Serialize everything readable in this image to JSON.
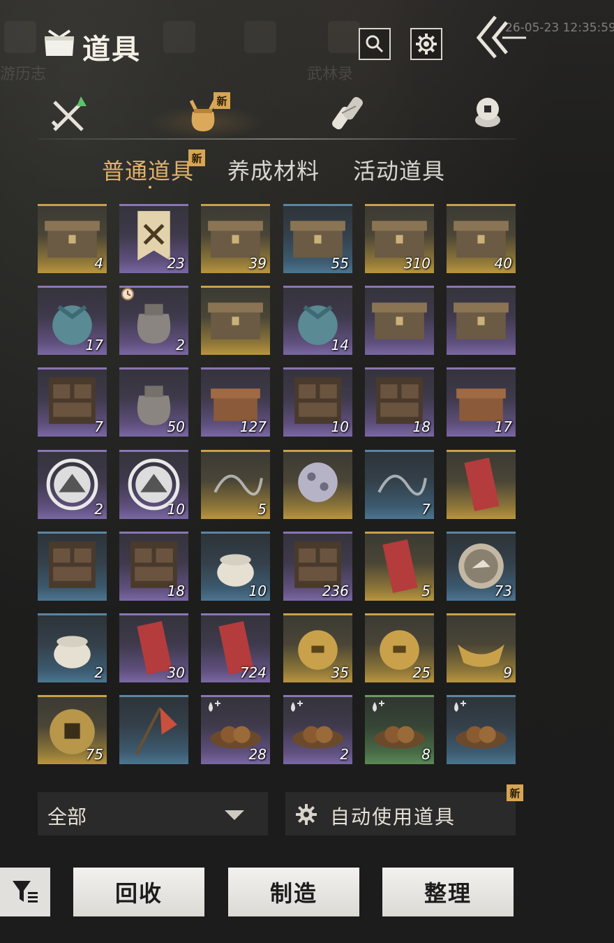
{
  "background": {
    "menu_items": [
      "游历志",
      "",
      "",
      "",
      "武林录",
      "",
      ""
    ],
    "timestamp": "26-05-23 12:35:59"
  },
  "header": {
    "title": "道具",
    "icons": [
      "bag-icon",
      "search-icon",
      "settings-icon",
      "back-icon"
    ]
  },
  "categories": [
    {
      "name": "equipment",
      "icon": "crossed-swords-icon",
      "new": false
    },
    {
      "name": "items",
      "icon": "pouch-icon",
      "new": true,
      "active": true
    },
    {
      "name": "scrolls",
      "icon": "scroll-icon",
      "new": false
    },
    {
      "name": "currency",
      "icon": "coin-stack-icon",
      "new": false
    }
  ],
  "new_tag": "新",
  "subtabs": [
    {
      "label": "普通道具",
      "active": true,
      "new": true
    },
    {
      "label": "养成材料",
      "active": false,
      "new": false
    },
    {
      "label": "活动道具",
      "active": false,
      "new": false
    }
  ],
  "items": [
    {
      "qty": "4",
      "rarity": "gold",
      "icon": "wooden-chest"
    },
    {
      "qty": "23",
      "rarity": "purple",
      "icon": "banner-crossed-swords"
    },
    {
      "qty": "39",
      "rarity": "gold",
      "icon": "chest-conch"
    },
    {
      "qty": "55",
      "rarity": "blue",
      "icon": "chest-leaf"
    },
    {
      "qty": "310",
      "rarity": "gold",
      "icon": "chest-ore"
    },
    {
      "qty": "40",
      "rarity": "gold",
      "icon": "chest-robe"
    },
    {
      "qty": "17",
      "rarity": "purple",
      "icon": "cloth-bundle"
    },
    {
      "qty": "2",
      "rarity": "purple",
      "icon": "gourd-bottle",
      "timed": true
    },
    {
      "qty": "",
      "rarity": "gold",
      "icon": "chest-plus-flower"
    },
    {
      "qty": "14",
      "rarity": "purple",
      "icon": "gift-bundle"
    },
    {
      "qty": "",
      "rarity": "purple",
      "icon": "chest-plus-box"
    },
    {
      "qty": "",
      "rarity": "purple",
      "icon": "chest-plus-scroll"
    },
    {
      "qty": "7",
      "rarity": "purple",
      "icon": "drawer-cabinet"
    },
    {
      "qty": "50",
      "rarity": "purple",
      "icon": "sack"
    },
    {
      "qty": "127",
      "rarity": "purple",
      "icon": "carved-box"
    },
    {
      "qty": "10",
      "rarity": "purple",
      "icon": "drawer-cabinet"
    },
    {
      "qty": "18",
      "rarity": "purple",
      "icon": "drawer-cabinet"
    },
    {
      "qty": "17",
      "rarity": "purple",
      "icon": "orb-pedestal"
    },
    {
      "qty": "2",
      "rarity": "purple",
      "icon": "cloud-emblem"
    },
    {
      "qty": "10",
      "rarity": "purple",
      "icon": "mountain-emblem"
    },
    {
      "qty": "5",
      "rarity": "gold",
      "icon": "wisp-dragon"
    },
    {
      "qty": "",
      "rarity": "gold",
      "icon": "pearl-ball"
    },
    {
      "qty": "7",
      "rarity": "blue",
      "icon": "wisp-spirit"
    },
    {
      "qty": "",
      "rarity": "gold",
      "icon": "red-envelope"
    },
    {
      "qty": "",
      "rarity": "blue",
      "icon": "drawer-box-blue"
    },
    {
      "qty": "18",
      "rarity": "purple",
      "icon": "drawer-box-green"
    },
    {
      "qty": "10",
      "rarity": "blue",
      "icon": "ceramic-jar"
    },
    {
      "qty": "236",
      "rarity": "purple",
      "icon": "drawer-box-red"
    },
    {
      "qty": "5",
      "rarity": "gold",
      "icon": "dark-token"
    },
    {
      "qty": "73",
      "rarity": "blue",
      "icon": "bird-medal"
    },
    {
      "qty": "2",
      "rarity": "blue",
      "icon": "wine-jar"
    },
    {
      "qty": "30",
      "rarity": "purple",
      "icon": "red-ticket"
    },
    {
      "qty": "724",
      "rarity": "purple",
      "icon": "black-ticket"
    },
    {
      "qty": "35",
      "rarity": "gold",
      "icon": "cat-bell"
    },
    {
      "qty": "25",
      "rarity": "gold",
      "icon": "gold-bell"
    },
    {
      "qty": "9",
      "rarity": "gold",
      "icon": "gold-ingot"
    },
    {
      "qty": "75",
      "rarity": "gold",
      "icon": "cat-coin"
    },
    {
      "qty": "",
      "rarity": "blue",
      "icon": "red-flag"
    },
    {
      "qty": "28",
      "rarity": "purple",
      "icon": "rice-balls",
      "consumable": true
    },
    {
      "qty": "2",
      "rarity": "purple",
      "icon": "stew-pot",
      "consumable": true
    },
    {
      "qty": "8",
      "rarity": "green",
      "icon": "meat-bowl",
      "consumable": true
    },
    {
      "qty": "",
      "rarity": "blue",
      "icon": "peach-board",
      "consumable": true
    }
  ],
  "filter": {
    "value": "全部"
  },
  "auto_use": {
    "label": "自动使用道具",
    "new": true
  },
  "actions": {
    "recycle": "回收",
    "craft": "制造",
    "sort": "整理"
  },
  "colors": {
    "accent": "#e1b26b",
    "new_badge": "#d7a553"
  }
}
